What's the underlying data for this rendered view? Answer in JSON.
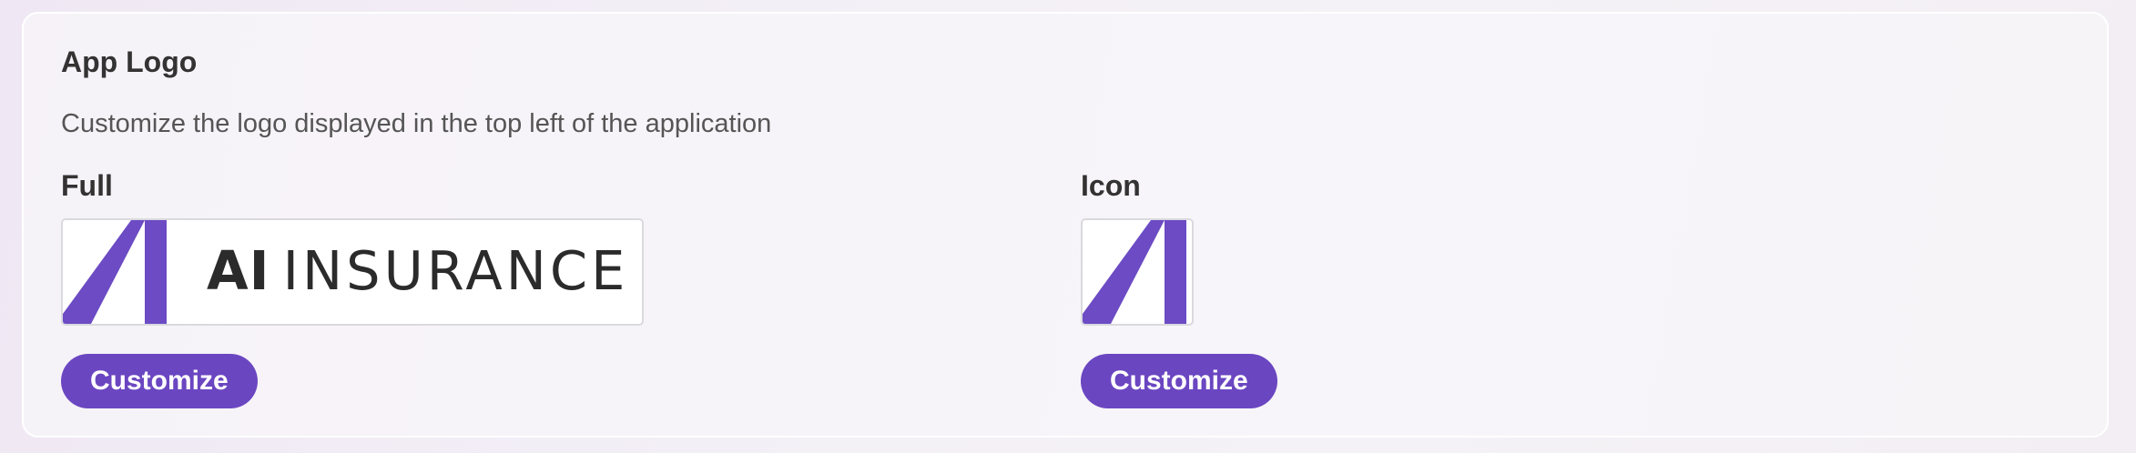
{
  "card": {
    "title": "App Logo",
    "description": "Customize the logo displayed in the top left of the application"
  },
  "full_logo": {
    "label": "Full",
    "brand_bold": "AI",
    "brand_light": "INSURANCE",
    "button_label": "Customize"
  },
  "icon_logo": {
    "label": "Icon",
    "button_label": "Customize"
  },
  "colors": {
    "accent": "#6b46c1",
    "logo_purple": "#6c4bc4"
  },
  "icons": {
    "full_logo_mark": "brand-logo-mark-icon",
    "icon_logo_mark": "brand-logo-mark-icon"
  }
}
